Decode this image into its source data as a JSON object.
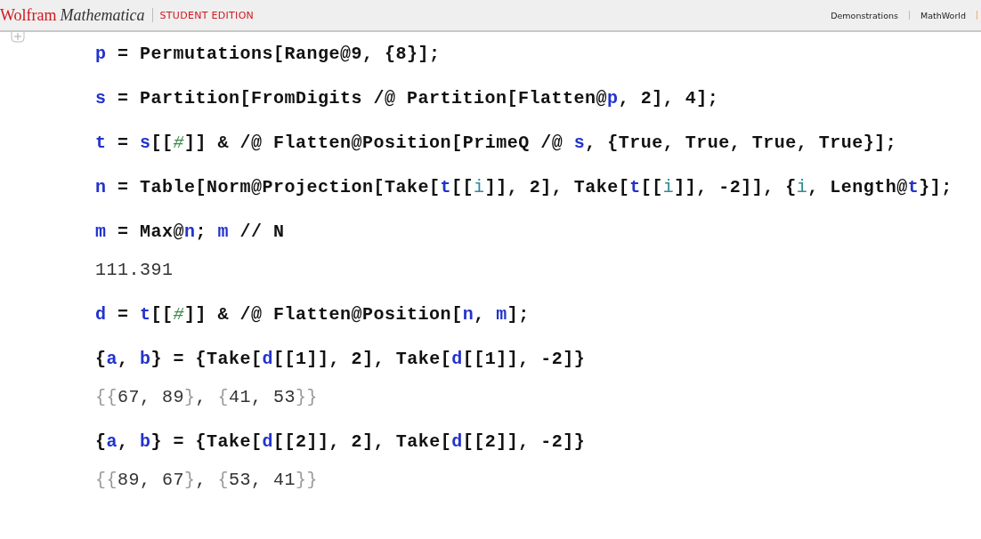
{
  "header": {
    "logo": {
      "brand": "Wolfram",
      "product": "Mathematica",
      "edition": "STUDENT EDITION"
    },
    "links": [
      "Demonstrations",
      "MathWorld"
    ]
  },
  "cells": [
    {
      "kind": "input",
      "tokens": [
        {
          "kind": "global",
          "text": "p"
        },
        {
          "kind": "plain",
          "text": " = Permutations[Range@9, {8}];"
        }
      ]
    },
    {
      "kind": "input",
      "tokens": [
        {
          "kind": "global",
          "text": "s"
        },
        {
          "kind": "plain",
          "text": " = Partition[FromDigits /@ Partition[Flatten@"
        },
        {
          "kind": "global",
          "text": "p"
        },
        {
          "kind": "plain",
          "text": ", 2], 4];"
        }
      ]
    },
    {
      "kind": "input",
      "tokens": [
        {
          "kind": "global",
          "text": "t"
        },
        {
          "kind": "plain",
          "text": " = "
        },
        {
          "kind": "global",
          "text": "s"
        },
        {
          "kind": "plain",
          "text": "[["
        },
        {
          "kind": "slot",
          "text": "#"
        },
        {
          "kind": "plain",
          "text": "]] & /@ Flatten@Position[PrimeQ /@ "
        },
        {
          "kind": "global",
          "text": "s"
        },
        {
          "kind": "plain",
          "text": ", {True, True, True, True}];"
        }
      ]
    },
    {
      "kind": "input",
      "tokens": [
        {
          "kind": "global",
          "text": "n"
        },
        {
          "kind": "plain",
          "text": " = Table[Norm@Projection[Take["
        },
        {
          "kind": "global",
          "text": "t"
        },
        {
          "kind": "plain",
          "text": "[["
        },
        {
          "kind": "local",
          "text": "i"
        },
        {
          "kind": "plain",
          "text": "]], 2], Take["
        },
        {
          "kind": "global",
          "text": "t"
        },
        {
          "kind": "plain",
          "text": "[["
        },
        {
          "kind": "local",
          "text": "i"
        },
        {
          "kind": "plain",
          "text": "]], -2]], {"
        },
        {
          "kind": "local",
          "text": "i"
        },
        {
          "kind": "plain",
          "text": ", Length@"
        },
        {
          "kind": "global",
          "text": "t"
        },
        {
          "kind": "plain",
          "text": "}];"
        }
      ]
    },
    {
      "kind": "input",
      "tokens": [
        {
          "kind": "global",
          "text": "m"
        },
        {
          "kind": "plain",
          "text": " = Max@"
        },
        {
          "kind": "global",
          "text": "n"
        },
        {
          "kind": "plain",
          "text": "; "
        },
        {
          "kind": "global",
          "text": "m"
        },
        {
          "kind": "plain",
          "text": " // N"
        }
      ]
    },
    {
      "kind": "output",
      "tokens": [
        {
          "kind": "plain",
          "text": "111.391"
        }
      ]
    },
    {
      "kind": "input",
      "tokens": [
        {
          "kind": "global",
          "text": "d"
        },
        {
          "kind": "plain",
          "text": " = "
        },
        {
          "kind": "global",
          "text": "t"
        },
        {
          "kind": "plain",
          "text": "[["
        },
        {
          "kind": "slot",
          "text": "#"
        },
        {
          "kind": "plain",
          "text": "]] & /@ Flatten@Position["
        },
        {
          "kind": "global",
          "text": "n"
        },
        {
          "kind": "plain",
          "text": ", "
        },
        {
          "kind": "global",
          "text": "m"
        },
        {
          "kind": "plain",
          "text": "];"
        }
      ]
    },
    {
      "kind": "input",
      "tokens": [
        {
          "kind": "plain",
          "text": "{"
        },
        {
          "kind": "global",
          "text": "a"
        },
        {
          "kind": "plain",
          "text": ", "
        },
        {
          "kind": "global",
          "text": "b"
        },
        {
          "kind": "plain",
          "text": "} = {Take["
        },
        {
          "kind": "global",
          "text": "d"
        },
        {
          "kind": "plain",
          "text": "[[1]], 2], Take["
        },
        {
          "kind": "global",
          "text": "d"
        },
        {
          "kind": "plain",
          "text": "[[1]], -2]}"
        }
      ]
    },
    {
      "kind": "output",
      "tokens": [
        {
          "kind": "brace",
          "text": "{{"
        },
        {
          "kind": "plain",
          "text": "67, 89"
        },
        {
          "kind": "brace",
          "text": "}"
        },
        {
          "kind": "plain",
          "text": ", "
        },
        {
          "kind": "brace",
          "text": "{"
        },
        {
          "kind": "plain",
          "text": "41, 53"
        },
        {
          "kind": "brace",
          "text": "}}"
        }
      ]
    },
    {
      "kind": "input",
      "tokens": [
        {
          "kind": "plain",
          "text": "{"
        },
        {
          "kind": "global",
          "text": "a"
        },
        {
          "kind": "plain",
          "text": ", "
        },
        {
          "kind": "global",
          "text": "b"
        },
        {
          "kind": "plain",
          "text": "} = {Take["
        },
        {
          "kind": "global",
          "text": "d"
        },
        {
          "kind": "plain",
          "text": "[[2]], 2], Take["
        },
        {
          "kind": "global",
          "text": "d"
        },
        {
          "kind": "plain",
          "text": "[[2]], -2]}"
        }
      ]
    },
    {
      "kind": "output",
      "tokens": [
        {
          "kind": "brace",
          "text": "{{"
        },
        {
          "kind": "plain",
          "text": "89, 67"
        },
        {
          "kind": "brace",
          "text": "}"
        },
        {
          "kind": "plain",
          "text": ", "
        },
        {
          "kind": "brace",
          "text": "{"
        },
        {
          "kind": "plain",
          "text": "53, 41"
        },
        {
          "kind": "brace",
          "text": "}}"
        }
      ]
    }
  ]
}
